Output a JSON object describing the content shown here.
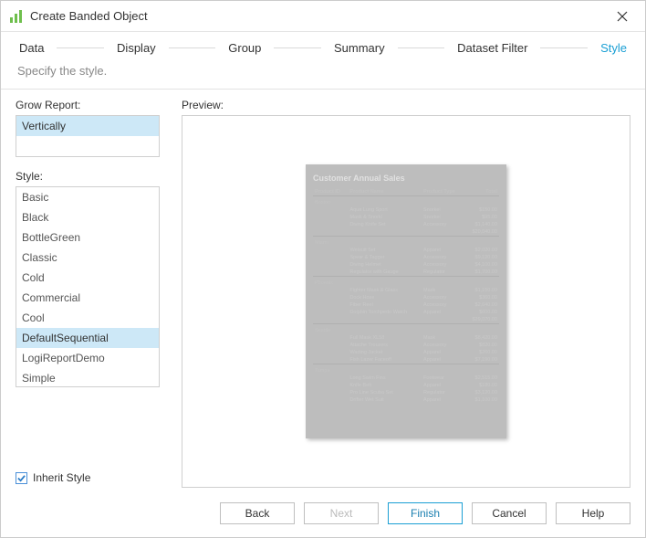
{
  "title": "Create Banded Object",
  "steps": [
    "Data",
    "Display",
    "Group",
    "Summary",
    "Dataset Filter",
    "Style"
  ],
  "active_step_index": 5,
  "subtitle": "Specify the style.",
  "left": {
    "grow_label": "Grow Report:",
    "grow_items": [
      "Vertically"
    ],
    "grow_selected": "Vertically",
    "style_label": "Style:",
    "styles": [
      "Basic",
      "Black",
      "BottleGreen",
      "Classic",
      "Cold",
      "Commercial",
      "Cool",
      "DefaultSequential",
      "LogiReportDemo",
      "Simple"
    ],
    "style_selected": "DefaultSequential",
    "inherit_label": "Inherit Style",
    "inherit_checked": true
  },
  "right": {
    "preview_label": "Preview:",
    "report_title": "Customer Annual Sales",
    "cols": [
      "Product ID",
      "Product Name",
      "Product Type",
      "Total"
    ],
    "groups": [
      {
        "name": "Boston",
        "rows": [
          [
            "Aqua Lung Sport",
            "Snorkel",
            "$150.00"
          ],
          [
            "Mask & Snorkl",
            "Snorkel",
            "$95.00"
          ],
          [
            "Diving Knife Set",
            "Accessory",
            "$1,140.00"
          ],
          [
            "",
            "",
            "$20,040.00"
          ]
        ]
      },
      {
        "name": "Miami",
        "rows": [
          [
            "Wetsuit Set",
            "Apparel",
            "$2,020.00"
          ],
          [
            "Spear & Tagger",
            "Accessory",
            "$9,120.00"
          ],
          [
            "Diving Helmet",
            "Accessory",
            "$4,100.00"
          ],
          [
            "Regulator with Gauge",
            "Regulator",
            "$1,700.00"
          ]
        ]
      },
      {
        "name": "Phoenix",
        "rows": [
          [
            "Fighter Mask & Glass",
            "Mask",
            "$1,150.00"
          ],
          [
            "Dock Hose",
            "Accessory",
            "$360.00"
          ],
          [
            "Fiber Reel",
            "Accessory",
            "$2,640.00"
          ],
          [
            "Dolphin Torchpedo Watch",
            "Apparel",
            "$600.00"
          ],
          [
            "",
            "",
            "$29,070.00"
          ]
        ]
      },
      {
        "name": "Seattle",
        "rows": [
          [
            "Full Mask XL58",
            "Mask",
            "$8,420.00"
          ],
          [
            "Attache Trousers",
            "Accessory",
            "$820.00"
          ],
          [
            "Wading Jacket",
            "Apparel",
            "$260.00"
          ],
          [
            "Fish Lazer Faceoff",
            "Apparel",
            "$7,190.00"
          ]
        ]
      },
      {
        "name": "Tampa",
        "rows": [
          [
            "Long Swim Fins",
            "Footwear",
            "$2,515.00"
          ],
          [
            "Knife Belt",
            "Apparel",
            "$180.00"
          ],
          [
            "Pro Line Scuba Set",
            "Regulator",
            "$3,120.00"
          ],
          [
            "Drifter Wet Suit",
            "Apparel",
            "$1,100.00"
          ]
        ]
      }
    ]
  },
  "buttons": {
    "back": "Back",
    "next": "Next",
    "finish": "Finish",
    "cancel": "Cancel",
    "help": "Help"
  }
}
